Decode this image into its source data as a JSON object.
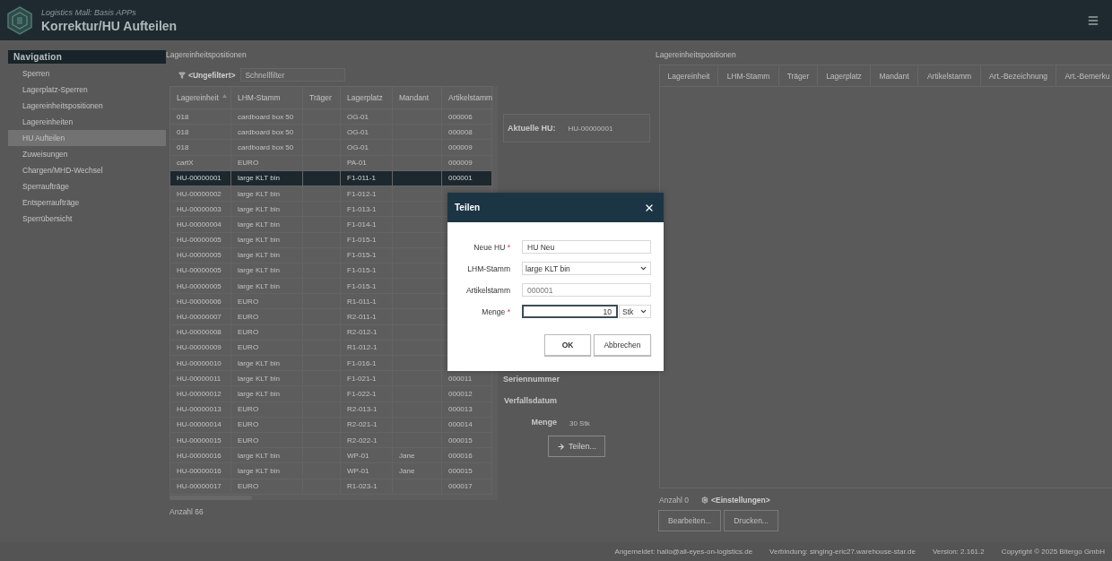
{
  "app": {
    "subtitle": "Logistics Mall: Basis APPs",
    "title": "Korrektur/HU Aufteilen"
  },
  "navigation": {
    "title": "Navigation",
    "items": [
      {
        "label": "Sperren",
        "selected": false
      },
      {
        "label": "Lagerplatz-Sperren",
        "selected": false
      },
      {
        "label": "Lagereinheitspositionen",
        "selected": false
      },
      {
        "label": "Lagereinheiten",
        "selected": false
      },
      {
        "label": "HU Aufteilen",
        "selected": true
      },
      {
        "label": "Zuweisungen",
        "selected": false
      },
      {
        "label": "Chargen/MHD-Wechsel",
        "selected": false
      },
      {
        "label": "Sperraufträge",
        "selected": false
      },
      {
        "label": "Entsperraufträge",
        "selected": false
      },
      {
        "label": "Sperrübersicht",
        "selected": false
      }
    ]
  },
  "left_panel": {
    "title": "Lagereinheitspositionen",
    "filter_label": "<Ungefiltert>",
    "quickfilter": {
      "placeholder": "Schnellfilter"
    },
    "table": {
      "columns": [
        {
          "label": "Lagereinheit",
          "sorted": true
        },
        {
          "label": "LHM-Stamm",
          "sorted": false
        },
        {
          "label": "Träger",
          "sorted": false
        },
        {
          "label": "Lagerplatz",
          "sorted": false
        },
        {
          "label": "Mandant",
          "sorted": false
        },
        {
          "label": "Artikelstamm",
          "sorted": false
        }
      ],
      "rows": [
        {
          "selected": false,
          "cells": [
            "018",
            "cardboard box 50",
            "",
            "OG-01",
            "",
            "000006"
          ]
        },
        {
          "selected": false,
          "cells": [
            "018",
            "cardboard box 50",
            "",
            "OG-01",
            "",
            "000008"
          ]
        },
        {
          "selected": false,
          "cells": [
            "018",
            "cardboard box 50",
            "",
            "OG-01",
            "",
            "000009"
          ]
        },
        {
          "selected": false,
          "cells": [
            "cartX",
            "EURO",
            "",
            "PA-01",
            "",
            "000009"
          ]
        },
        {
          "selected": true,
          "cells": [
            "HU-00000001",
            "large KLT bin",
            "",
            "F1-011-1",
            "",
            "000001"
          ]
        },
        {
          "selected": false,
          "cells": [
            "HU-00000002",
            "large KLT bin",
            "",
            "F1-012-1",
            ""
          ]
        },
        {
          "selected": false,
          "cells": [
            "HU-00000003",
            "large KLT bin",
            "",
            "F1-013-1",
            ""
          ]
        },
        {
          "selected": false,
          "cells": [
            "HU-00000004",
            "large KLT bin",
            "",
            "F1-014-1",
            ""
          ]
        },
        {
          "selected": false,
          "cells": [
            "HU-00000005",
            "large KLT bin",
            "",
            "F1-015-1",
            ""
          ]
        },
        {
          "selected": false,
          "cells": [
            "HU-00000005",
            "large KLT bin",
            "",
            "F1-015-1",
            ""
          ]
        },
        {
          "selected": false,
          "cells": [
            "HU-00000005",
            "large KLT bin",
            "",
            "F1-015-1",
            ""
          ]
        },
        {
          "selected": false,
          "cells": [
            "HU-00000005",
            "large KLT bin",
            "",
            "F1-015-1",
            ""
          ]
        },
        {
          "selected": false,
          "cells": [
            "HU-00000006",
            "EURO",
            "",
            "R1-011-1",
            ""
          ]
        },
        {
          "selected": false,
          "cells": [
            "HU-00000007",
            "EURO",
            "",
            "R2-011-1",
            ""
          ]
        },
        {
          "selected": false,
          "cells": [
            "HU-00000008",
            "EURO",
            "",
            "R2-012-1",
            ""
          ]
        },
        {
          "selected": false,
          "cells": [
            "HU-00000009",
            "EURO",
            "",
            "R1-012-1",
            ""
          ]
        },
        {
          "selected": false,
          "cells": [
            "HU-00000010",
            "large KLT bin",
            "",
            "F1-016-1",
            ""
          ]
        },
        {
          "selected": false,
          "cells": [
            "HU-00000011",
            "large KLT bin",
            "",
            "F1-021-1",
            "",
            "000011"
          ]
        },
        {
          "selected": false,
          "cells": [
            "HU-00000012",
            "large KLT bin",
            "",
            "F1-022-1",
            "",
            "000012"
          ]
        },
        {
          "selected": false,
          "cells": [
            "HU-00000013",
            "EURO",
            "",
            "R2-013-1",
            "",
            "000013"
          ]
        },
        {
          "selected": false,
          "cells": [
            "HU-00000014",
            "EURO",
            "",
            "R2-021-1",
            "",
            "000014"
          ]
        },
        {
          "selected": false,
          "cells": [
            "HU-00000015",
            "EURO",
            "",
            "R2-022-1",
            "",
            "000015"
          ]
        },
        {
          "selected": false,
          "cells": [
            "HU-00000016",
            "large KLT bin",
            "",
            "WP-01",
            "Jane",
            "000016"
          ]
        },
        {
          "selected": false,
          "cells": [
            "HU-00000016",
            "large KLT bin",
            "",
            "WP-01",
            "Jane",
            "000015"
          ]
        },
        {
          "selected": false,
          "cells": [
            "HU-00000017",
            "EURO",
            "",
            "R1-023-1",
            "",
            "000017"
          ]
        }
      ]
    },
    "count": "Anzahl 66"
  },
  "middle": {
    "current_hu": {
      "label": "Aktuelle HU:",
      "value": "HU-00000001"
    },
    "fields": [
      {
        "label": "Seriennummer"
      },
      {
        "label": "Verfallsdatum"
      },
      {
        "label": "Menge",
        "value": "30 Stk"
      }
    ],
    "split_button": "Teilen..."
  },
  "right_panel": {
    "title": "Lagereinheitspositionen",
    "columns": [
      "Lagereinheit",
      "LHM-Stamm",
      "Träger",
      "Lagerplatz",
      "Mandant",
      "Artikelstamm",
      "Art.-Bezeichnung",
      "Art.-Bemerku"
    ],
    "count": "Anzahl 0",
    "settings": "<Einstellungen>",
    "buttons": [
      "Bearbeiten...",
      "Drucken..."
    ]
  },
  "status_bar": [
    "Angemeldet: hallo@all-eyes-on-logistics.de",
    "Verbindung: singing-eric27.warehouse-star.de",
    "Version: 2.161.2",
    "Copyright © 2025 Bitergo GmbH"
  ],
  "dialog": {
    "title": "Teilen",
    "fields": [
      {
        "kind": "text",
        "label": "Neue HU",
        "required_mark": "*",
        "value": "HU Neu"
      },
      {
        "kind": "select",
        "label": "LHM-Stamm",
        "value": "large KLT bin"
      },
      {
        "kind": "readonly",
        "label": "Artikelstamm",
        "value": "000001"
      },
      {
        "kind": "quantity",
        "label": "Menge",
        "required_mark": "*",
        "value": "10",
        "unit": "Stk",
        "focused": true
      }
    ],
    "buttons": [
      "OK",
      "Abbrechen"
    ]
  }
}
